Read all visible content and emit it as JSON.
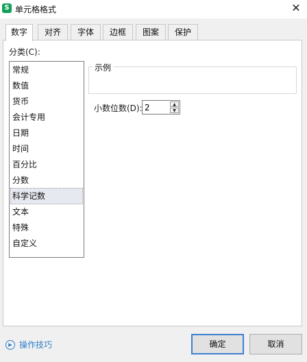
{
  "window": {
    "title": "单元格格式",
    "app_icon_letter": "S",
    "close_glyph": "✕"
  },
  "tabs": [
    {
      "label": "数字",
      "active": true
    },
    {
      "label": "对齐",
      "active": false
    },
    {
      "label": "字体",
      "active": false
    },
    {
      "label": "边框",
      "active": false
    },
    {
      "label": "图案",
      "active": false
    },
    {
      "label": "保护",
      "active": false
    }
  ],
  "category": {
    "label": "分类(C):",
    "items": [
      "常规",
      "数值",
      "货币",
      "会计专用",
      "日期",
      "时间",
      "百分比",
      "分数",
      "科学记数",
      "文本",
      "特殊",
      "自定义"
    ],
    "selected": "科学记数"
  },
  "sample": {
    "label": "示例"
  },
  "decimal": {
    "label": "小数位数(D):",
    "value": "2"
  },
  "help": {
    "label": "操作技巧"
  },
  "buttons": {
    "ok": "确定",
    "cancel": "取消"
  },
  "colors": {
    "accent": "#3c7fd0",
    "link": "#2f7ec9",
    "app_icon": "#14a05a"
  }
}
